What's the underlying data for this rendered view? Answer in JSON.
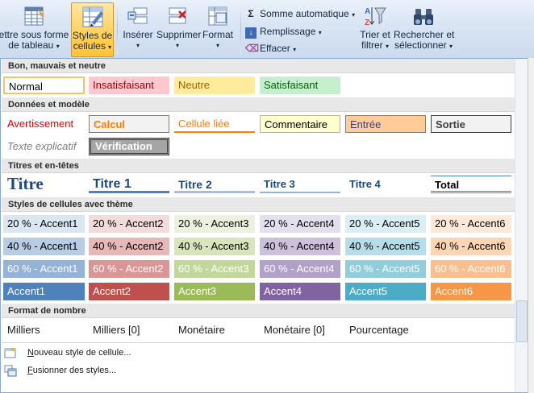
{
  "ribbon": {
    "format_table": {
      "line1": "ettre sous forme",
      "line2": "de tableau"
    },
    "cell_styles": {
      "line1": "Styles de",
      "line2": "cellules"
    },
    "insert": "Insérer",
    "delete": "Supprimer",
    "format": "Format",
    "autosum": "Somme automatique",
    "fill": "Remplissage",
    "clear": "Effacer",
    "sort_filter": {
      "line1": "Trier et",
      "line2": "filtrer"
    },
    "find_select": {
      "line1": "Rechercher et",
      "line2": "sélectionner"
    }
  },
  "sections": {
    "good_bad": "Bon, mauvais et neutre",
    "data_model": "Données et modèle",
    "titles": "Titres et en-têtes",
    "themed": "Styles de cellules avec thème",
    "number": "Format de nombre"
  },
  "good_bad": [
    "Normal",
    "Insatisfaisant",
    "Neutre",
    "Satisfaisant"
  ],
  "data_model": {
    "row1": [
      "Avertissement",
      "Calcul",
      "Cellule liée",
      "Commentaire",
      "Entrée",
      "Sortie"
    ],
    "row2": [
      "Texte explicatif",
      "Vérification"
    ]
  },
  "titles": [
    "Titre",
    "Titre 1",
    "Titre 2",
    "Titre 3",
    "Titre 4",
    "Total"
  ],
  "themed": {
    "row20": [
      "20 % - Accent1",
      "20 % - Accent2",
      "20 % - Accent3",
      "20 % - Accent4",
      "20 % - Accent5",
      "20 % - Accent6"
    ],
    "row40": [
      "40 % - Accent1",
      "40 % - Accent2",
      "40 % - Accent3",
      "40 % - Accent4",
      "40 % - Accent5",
      "40 % - Accent6"
    ],
    "row60": [
      "60 % - Accent1",
      "60 % - Accent2",
      "60 % - Accent3",
      "60 % - Accent4",
      "60 % - Accent5",
      "60 % - Accent6"
    ],
    "row100": [
      "Accent1",
      "Accent2",
      "Accent3",
      "Accent4",
      "Accent5",
      "Accent6"
    ]
  },
  "number_formats": [
    "Milliers",
    "Milliers [0]",
    "Monétaire",
    "Monétaire [0]",
    "Pourcentage"
  ],
  "menu": {
    "new_style": {
      "accel": "N",
      "rest": "ouveau style de cellule..."
    },
    "merge_styles": {
      "accel": "F",
      "rest": "usionner des styles..."
    }
  },
  "colors": {
    "accent1": "#4f81bd",
    "accent2": "#c0504d",
    "accent3": "#9bbb59",
    "accent4": "#8064a2",
    "accent5": "#4bacc6",
    "accent6": "#f79646"
  }
}
